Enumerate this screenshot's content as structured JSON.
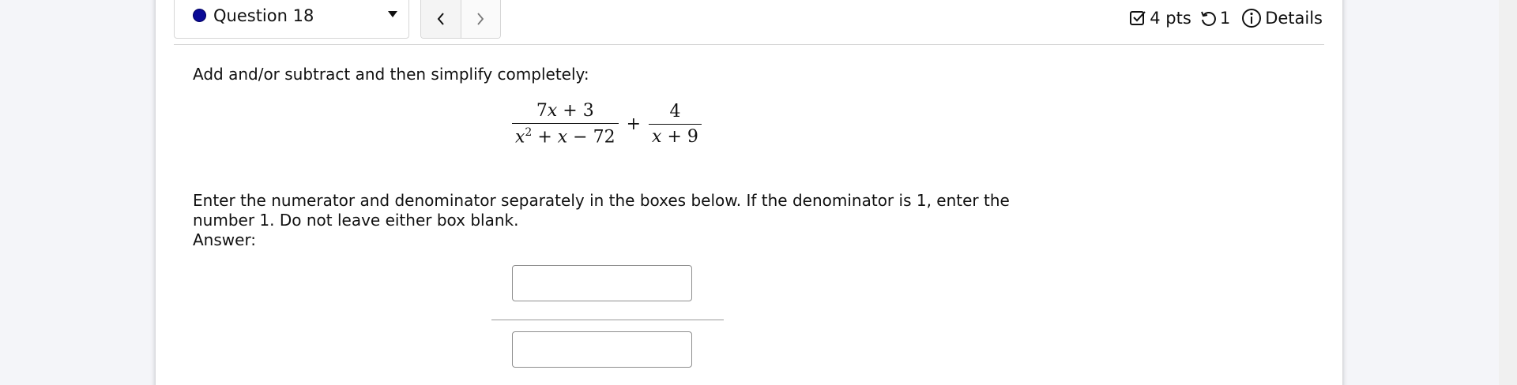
{
  "header": {
    "question_label": "Question 18",
    "points": "4 pts",
    "attempts": "1",
    "details_label": "Details"
  },
  "question": {
    "prompt": "Add and/or subtract and then simplify completely:",
    "expression": {
      "term1_numerator": "7x + 3",
      "term1_denominator": "x² + x − 72",
      "operator": "+",
      "term2_numerator": "4",
      "term2_denominator": "x + 9"
    },
    "instructions": "Enter the numerator and denominator separately in the boxes below. If the denominator is 1, enter the number 1. Do not leave either box blank.",
    "answer_label": "Answer:"
  },
  "answer": {
    "numerator_value": "",
    "denominator_value": ""
  },
  "icons": {
    "status": "status-dot-icon",
    "caret": "caret-down-icon",
    "prev": "chevron-left-icon",
    "next": "chevron-right-icon",
    "points": "checkbox-icon",
    "attempts": "retry-icon",
    "details": "info-icon"
  },
  "colors": {
    "status_dot": "#0a0a96"
  }
}
